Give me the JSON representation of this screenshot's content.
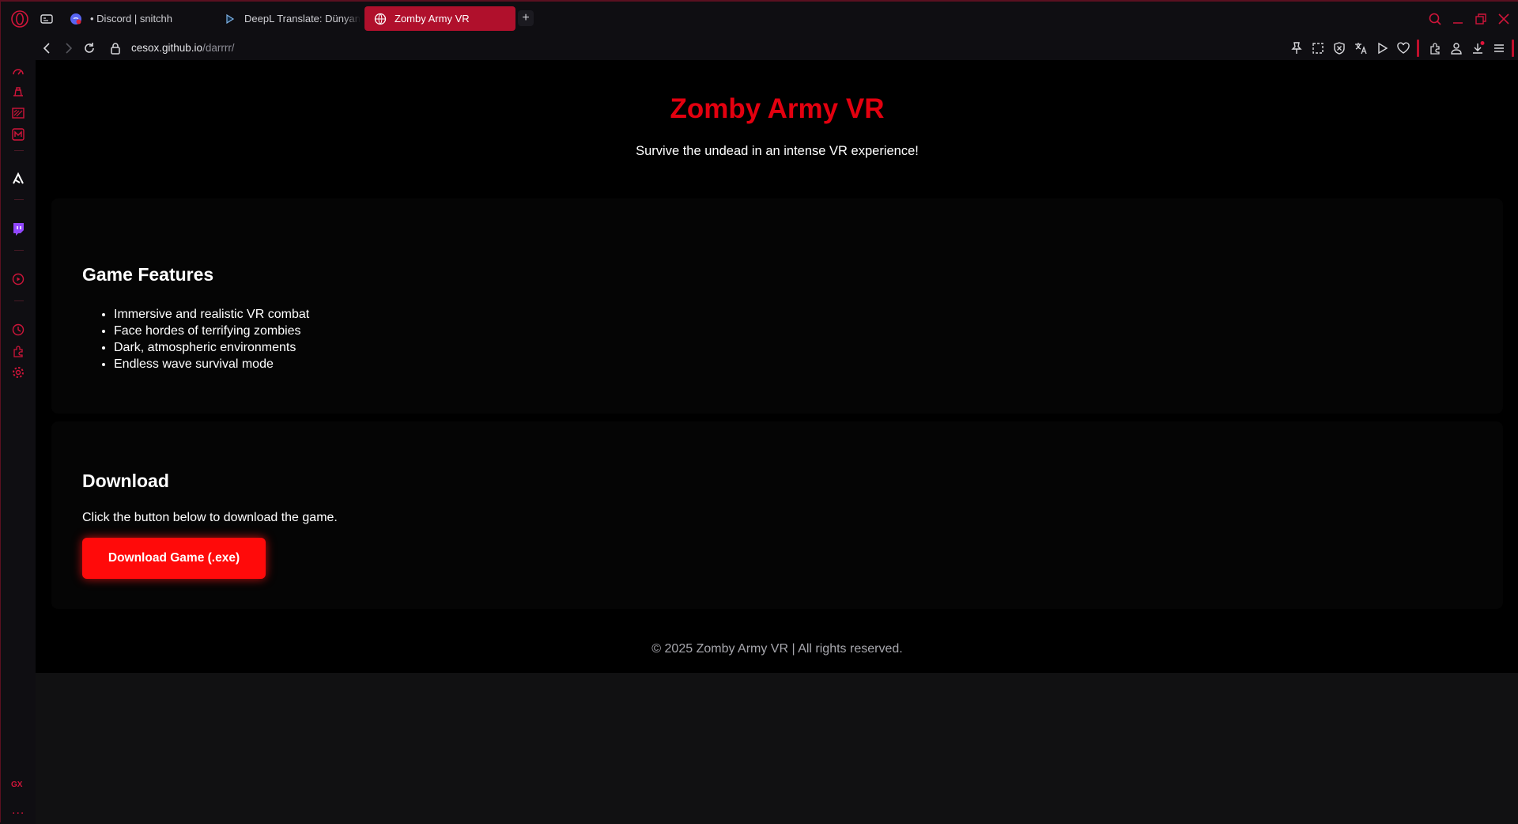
{
  "colors": {
    "accent": "#b0102c",
    "page_title": "#e3000f",
    "button": "#ff0a0a"
  },
  "tabs": [
    {
      "label": "• Discord | snitchh",
      "icon": "discord-icon"
    },
    {
      "label": "DeepL Translate: Dünyanın",
      "icon": "deepl-icon"
    },
    {
      "label": "Zomby Army VR",
      "icon": "globe-icon",
      "active": true
    }
  ],
  "newtab_label": "+",
  "address": {
    "host": "cesox.github.io",
    "path": "/darrrr/"
  },
  "toolbar_icons": [
    "pin-icon",
    "snapshot-icon",
    "adblock-icon",
    "translate-icon",
    "play-icon",
    "heart-icon",
    "extensions-icon",
    "profile-icon",
    "download-icon",
    "easy-setup-icon"
  ],
  "sidebar": {
    "items": [
      "speed-dial-icon",
      "gx-corner-icon",
      "news-icon",
      "messenger-m-icon",
      "aria-icon",
      "twitch-icon",
      "player-icon",
      "history-icon",
      "extensions-icon",
      "settings-icon"
    ],
    "gx_label": "GX",
    "more_label": "..."
  },
  "page": {
    "title": "Zomby Army VR",
    "subtitle": "Survive the undead in an intense VR experience!",
    "features": {
      "heading": "Game Features",
      "items": [
        "Immersive and realistic VR combat",
        "Face hordes of terrifying zombies",
        "Dark, atmospheric environments",
        "Endless wave survival mode"
      ]
    },
    "download": {
      "heading": "Download",
      "text": "Click the button below to download the game.",
      "button": "Download Game (.exe)"
    },
    "footer": "© 2025 Zomby Army VR | All rights reserved."
  }
}
